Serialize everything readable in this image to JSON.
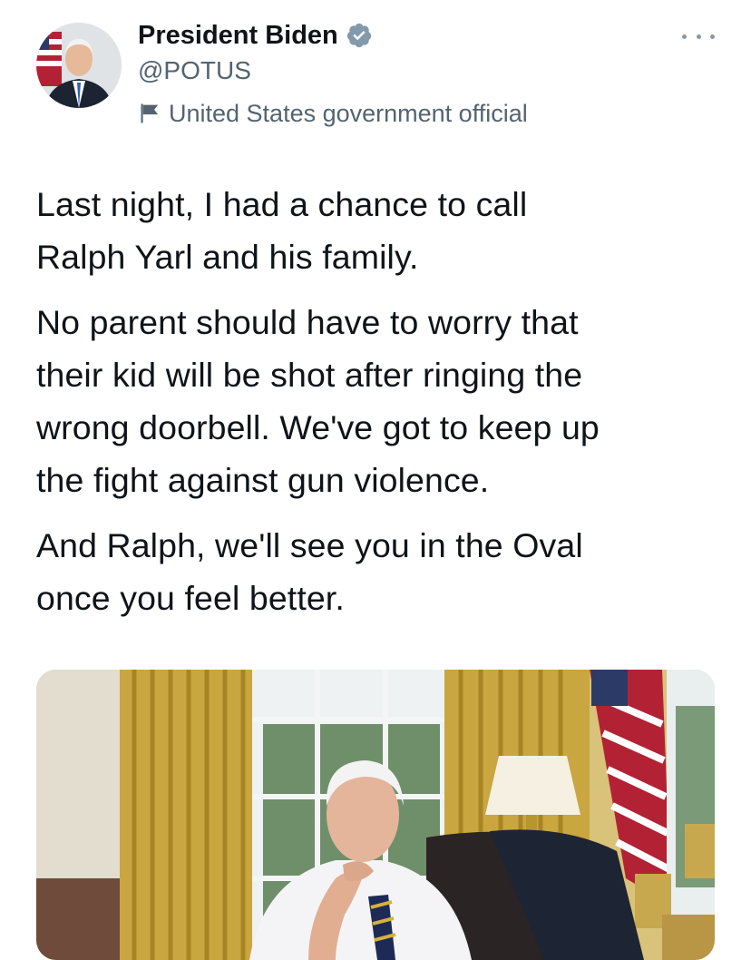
{
  "tweet": {
    "author": {
      "display_name": "President Biden",
      "handle": "@POTUS",
      "verified_icon": "verified-badge-icon",
      "label": "United States government official",
      "label_icon": "flag-icon",
      "avatar_alt": "avatar"
    },
    "more_icon": "more-options-icon",
    "text": [
      "Last night, I had a chance to call\nRalph Yarl and his family.",
      "No parent should have to worry that\ntheir kid will be shot after ringing the\nwrong doorbell. We've got to keep up\nthe fight against gun violence.",
      "And Ralph, we'll see you in the Oval\nonce you feel better."
    ],
    "media": {
      "type": "photo"
    }
  },
  "colors": {
    "text": "#0f1419",
    "secondary": "#536471",
    "verified_badge": "#829aab",
    "background": "#ffffff"
  }
}
